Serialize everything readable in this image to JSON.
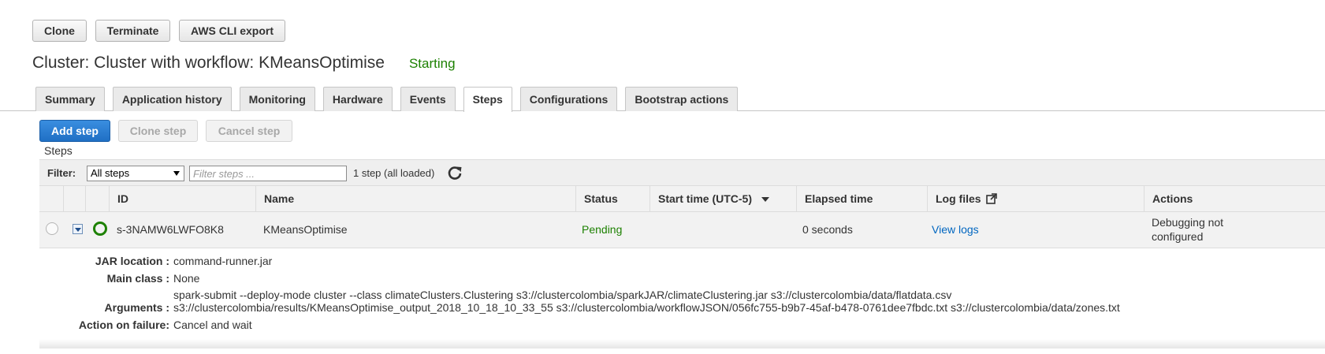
{
  "toolbar": {
    "clone_label": "Clone",
    "terminate_label": "Terminate",
    "cli_export_label": "AWS CLI export"
  },
  "cluster": {
    "title": "Cluster: Cluster with workflow: KMeansOptimise",
    "status": "Starting",
    "status_color": "#1d8102"
  },
  "tabs": [
    {
      "label": "Summary",
      "active": false
    },
    {
      "label": "Application history",
      "active": false
    },
    {
      "label": "Monitoring",
      "active": false
    },
    {
      "label": "Hardware",
      "active": false
    },
    {
      "label": "Events",
      "active": false
    },
    {
      "label": "Steps",
      "active": true
    },
    {
      "label": "Configurations",
      "active": false
    },
    {
      "label": "Bootstrap actions",
      "active": false
    }
  ],
  "step_actions": {
    "add_label": "Add step",
    "clone_label": "Clone step",
    "cancel_label": "Cancel step",
    "primary_color": "#1f6fc4"
  },
  "steps_section_label": "Steps",
  "filter": {
    "label": "Filter:",
    "selected_option": "All steps",
    "input_placeholder": "Filter steps ...",
    "input_value": "",
    "count_text": "1 step (all loaded)",
    "refresh_icon": "refresh-icon"
  },
  "table": {
    "headers": {
      "id": "ID",
      "name": "Name",
      "status": "Status",
      "start_time": "Start time (UTC-5)",
      "elapsed": "Elapsed time",
      "log_files": "Log files",
      "actions": "Actions"
    },
    "rows": [
      {
        "id": "s-3NAMW6LWFO8K8",
        "name": "KMeansOptimise",
        "status": "Pending",
        "start_time": "",
        "elapsed": "0 seconds",
        "log_files": "View logs",
        "actions_line1": "Debugging not",
        "actions_line2": "configured"
      }
    ]
  },
  "details": {
    "jar_location_label": "JAR location :",
    "jar_location": "command-runner.jar",
    "main_class_label": "Main class :",
    "main_class": "None",
    "arguments_label": "Arguments :",
    "arguments_line1": "spark-submit --deploy-mode cluster --class climateClusters.Clustering s3://clustercolombia/sparkJAR/climateClustering.jar s3://clustercolombia/data/flatdata.csv",
    "arguments_line2": "s3://clustercolombia/results/KMeansOptimise_output_2018_10_18_10_33_55 s3://clustercolombia/workflowJSON/056fc755-b9b7-45af-b478-0761dee7fbdc.txt s3://clustercolombia/data/zones.txt",
    "action_on_failure_label": "Action on failure:",
    "action_on_failure": "Cancel and wait"
  }
}
